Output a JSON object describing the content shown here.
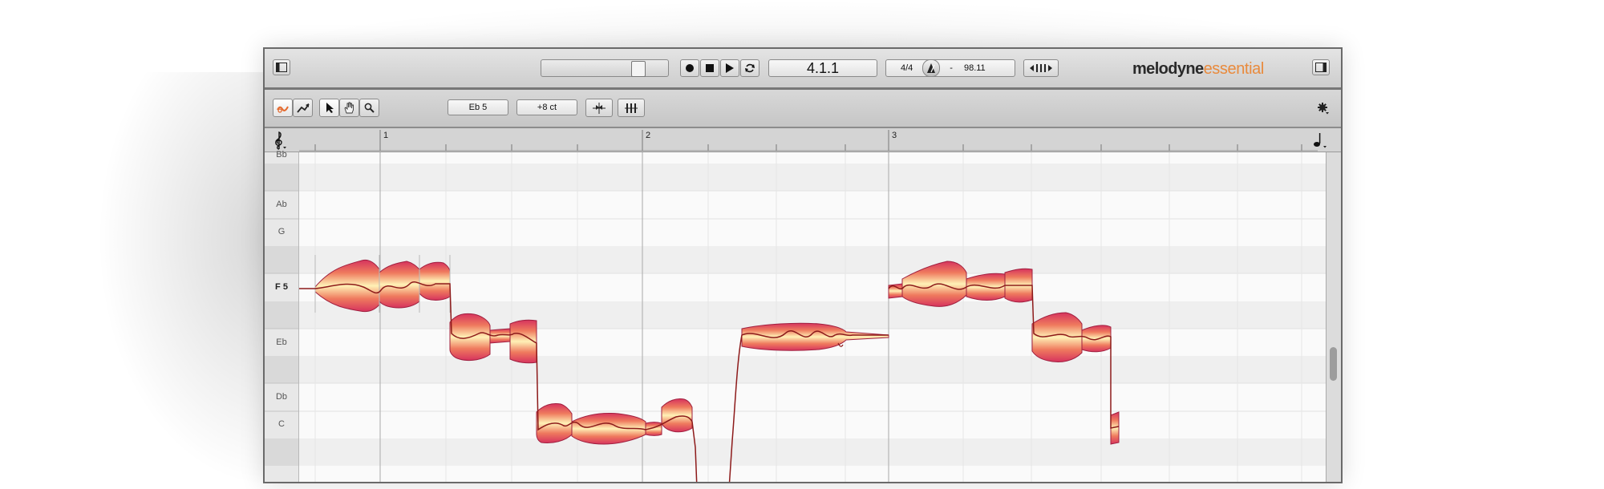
{
  "app": {
    "logo_main": "melodyne",
    "logo_sub": "essential"
  },
  "transport": {
    "position": "4.1.1",
    "time_signature": "4/4",
    "tempo_separator": "-",
    "tempo": "98.11"
  },
  "toolbar": {
    "pitch_field": "Eb 5",
    "cents_field": "+8 ct"
  },
  "ruler": {
    "bars": [
      "1",
      "2",
      "3"
    ]
  },
  "piano_keys": {
    "top_partial": "Bb",
    "labels": [
      {
        "name": "Ab",
        "bold": false
      },
      {
        "name": "G",
        "bold": false
      },
      {
        "name": "F 5",
        "bold": true
      },
      {
        "name": "Eb",
        "bold": false
      },
      {
        "name": "Db",
        "bold": false
      },
      {
        "name": "C",
        "bold": false
      }
    ]
  },
  "colors": {
    "blob_outer": "#d6335e",
    "blob_mid": "#ef7a5e",
    "blob_inner": "#fff1b6",
    "pitch_curve": "#8d1a1a",
    "accent": "#e98a3c"
  },
  "icons": {
    "left_panel": "panel-left-icon",
    "right_panel": "panel-right-icon",
    "record": "record-icon",
    "stop": "stop-icon",
    "play": "play-icon",
    "loop": "loop-icon",
    "metronome": "metronome-icon",
    "tempo_detect": "tempo-detect-icon",
    "pitch_tool": "pitch-tool-icon",
    "pitch_modulation_tool": "pitch-modulation-tool-icon",
    "pointer_tool": "pointer-tool-icon",
    "hand_tool": "hand-tool-icon",
    "zoom_tool": "zoom-tool-icon",
    "quantize_pitch": "quantize-pitch-icon",
    "quantize_time": "quantize-time-icon",
    "settings": "gear-icon",
    "clef": "treble-clef-icon",
    "note_value": "note-icon"
  }
}
